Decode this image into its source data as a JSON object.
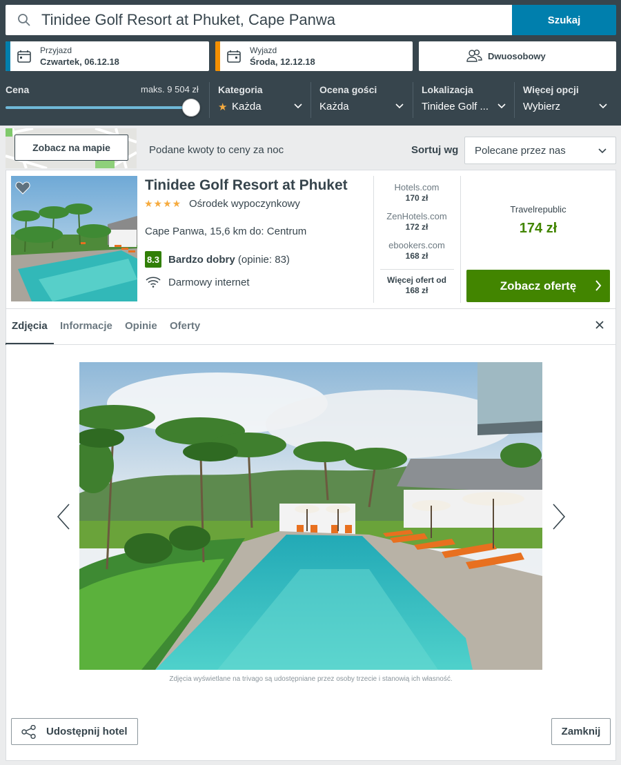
{
  "search": {
    "query": "Tinidee Golf Resort at Phuket, Cape Panwa",
    "button": "Szukaj"
  },
  "checkin": {
    "label": "Przyjazd",
    "value": "Czwartek, 06.12.18",
    "accent": "#007fad"
  },
  "checkout": {
    "label": "Wyjazd",
    "value": "Środa, 12.12.18",
    "accent": "#f48f00"
  },
  "room": {
    "label": "Dwuosobowy"
  },
  "filters": {
    "price": {
      "label": "Cena",
      "max": "maks. 9 504 zł",
      "slider_level": 1.0
    },
    "category": {
      "label": "Kategoria",
      "value": "Każda"
    },
    "rating": {
      "label": "Ocena gości",
      "value": "Każda"
    },
    "location": {
      "label": "Lokalizacja",
      "value": "Tinidee Golf ..."
    },
    "more": {
      "label": "Więcej opcji",
      "value": "Wybierz"
    }
  },
  "toolbar": {
    "map_button": "Zobacz na mapie",
    "price_note": "Podane kwoty to ceny za noc",
    "sort_label": "Sortuj wg",
    "sort_value": "Polecane przez nas"
  },
  "hotel": {
    "name": "Tinidee Golf Resort at Phuket",
    "stars": "★★★★",
    "type": "Ośrodek wypoczynkowy",
    "location": "Cape Panwa, 15,6 km do: Centrum",
    "rating_score": "8.3",
    "rating_label": "Bardzo dobry",
    "rating_count": "(opinie: 83)",
    "amenity": "Darmowy internet",
    "rating_color": "#317f07"
  },
  "offers": [
    {
      "site": "Hotels.com",
      "price": "170 zł"
    },
    {
      "site": "ZenHotels.com",
      "price": "172 zł"
    },
    {
      "site": "ebookers.com",
      "price": "168 zł"
    }
  ],
  "more_offers": {
    "label": "Więcej ofert od",
    "price": "168 zł"
  },
  "best_offer": {
    "site": "Travelrepublic",
    "price": "174 zł",
    "button": "Zobacz ofertę",
    "color": "#428500"
  },
  "tabs": [
    "Zdjęcia",
    "Informacje",
    "Opinie",
    "Oferty"
  ],
  "gallery": {
    "disclaimer": "Zdjęcia wyświetlane na trivago są udostępniane przez osoby trzecie i stanowią ich własność."
  },
  "footer": {
    "share": "Udostępnij hotel",
    "close": "Zamknij"
  }
}
